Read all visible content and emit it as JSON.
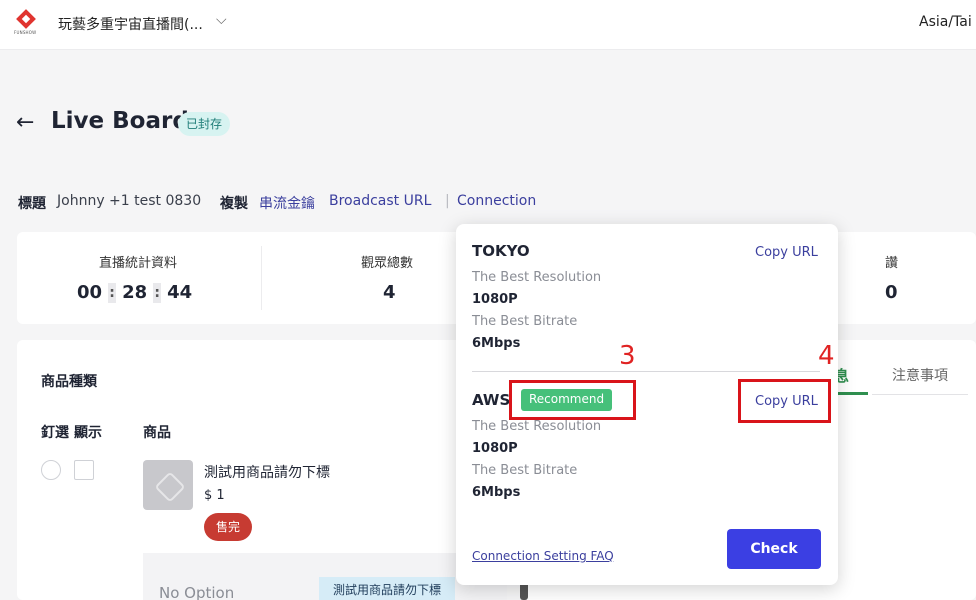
{
  "topbar": {
    "logo_text": "FUNSHOW",
    "project_name": "玩藝多重宇宙直播間(...",
    "timezone": "Asia/Tai"
  },
  "header": {
    "title": "Live Board",
    "status_badge": "已封存"
  },
  "info": {
    "title_label": "標題",
    "title_value": "Johnny +1 test 0830",
    "copy_label": "複製",
    "stream_key_link": "串流金鑰",
    "broadcast_url_link": "Broadcast URL",
    "separator": "|",
    "connection_link": "Connection"
  },
  "stats": {
    "live_stats_label": "直播統計資料",
    "hours": "00",
    "minutes": "28",
    "seconds": "44",
    "colon": ":",
    "viewers_label": "觀眾總數",
    "viewers_value": "4",
    "third_label": "讚",
    "third_value": "0"
  },
  "products": {
    "section_title": "商品種類",
    "col_pin": "釘選",
    "col_show": "顯示",
    "col_product": "商品",
    "item_name": "測試用商品請勿下標",
    "item_price": "$ 1",
    "soldout_label": "售完",
    "no_option": "No Option",
    "option_tag": "測試用商品請勿下標"
  },
  "tabs": {
    "active_partial": "息",
    "notes": "注意事項"
  },
  "connection_popover": {
    "tokyo": {
      "name": "TOKYO",
      "copy_url": "Copy URL",
      "resolution_label": "The Best Resolution",
      "resolution_value": "1080P",
      "bitrate_label": "The Best Bitrate",
      "bitrate_value": "6Mbps"
    },
    "aws": {
      "name": "AWS",
      "recommend_badge": "Recommend",
      "copy_url": "Copy URL",
      "resolution_label": "The Best Resolution",
      "resolution_value": "1080P",
      "bitrate_label": "The Best Bitrate",
      "bitrate_value": "6Mbps"
    },
    "faq_link": "Connection Setting FAQ",
    "check_button": "Check"
  },
  "annotations": {
    "num_3": "3",
    "num_4": "4",
    "color": "#d9141a"
  }
}
